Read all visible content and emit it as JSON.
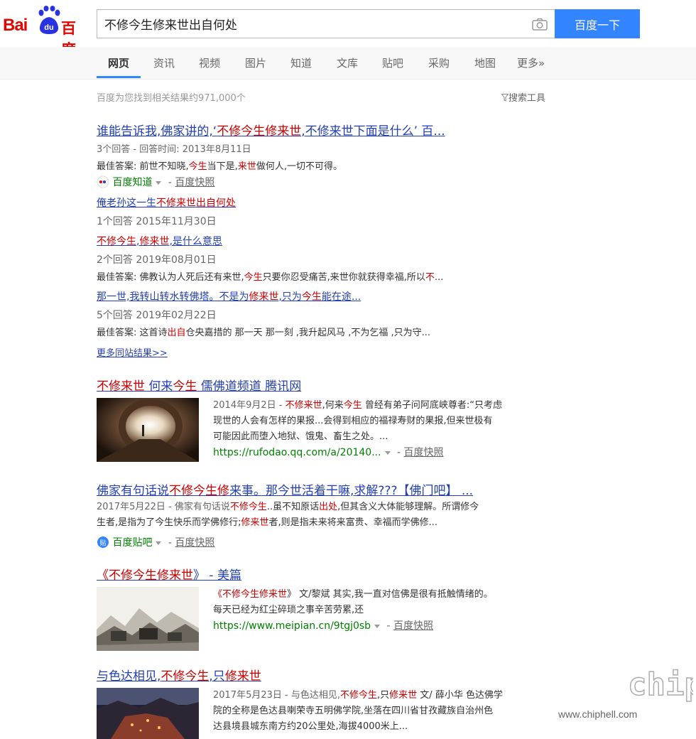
{
  "header": {
    "logo_left": "Bai",
    "logo_paw": "du",
    "logo_right": "百度",
    "query": "不修今生修来世出自何处",
    "search_button": "百度一下"
  },
  "tabs": [
    "网页",
    "资讯",
    "视频",
    "图片",
    "知道",
    "文库",
    "贴吧",
    "采购",
    "地图",
    "更多»"
  ],
  "meta": {
    "count": "百度为您找到相关结果约971,000个",
    "tools": "搜索工具"
  },
  "r1": {
    "t1": "谁能告诉我,佛家讲的,‘",
    "t2": "不修今生修来世",
    "t3": ",不修来世下面是什么’ 百...",
    "info": "3个回答 - 回答时间: 2013年8月11日",
    "a1": "最佳答案: 前世不知晓,",
    "a2": "今生",
    "a3": "当下是,",
    "a4": "来世",
    "a5": "做何人,一切不可得。",
    "source": "百度知道",
    "snap": "百度快照",
    "sub1_t1": "俺老孙这一生",
    "sub1_t2": "不修来世出自何处",
    "sub1_info": "1个回答  2015年11月30日",
    "sub2_t1": "不修今生",
    "sub2_t2": ",",
    "sub2_t3": "修来世",
    "sub2_t4": ",是什么意思",
    "sub2_info": "2个回答  2019年08月01日",
    "sub2_a1": "最佳答案:  佛教认为人死后还有来世,",
    "sub2_a2": "今生",
    "sub2_a3": "只要你忍受痛苦,来世你就获得幸福,所以",
    "sub2_a4": "不",
    "sub2_a5": "...",
    "sub3_t1": "那一世,我转山转水转佛塔。不是为",
    "sub3_t2": "修来世",
    "sub3_t3": ",只为",
    "sub3_t4": "今生",
    "sub3_t5": "能在途...",
    "sub3_info": "5个回答  2019年02月22日",
    "sub3_a1": "最佳答案:  这首诗",
    "sub3_a2": "出自",
    "sub3_a3": "仓央嘉措的 那一天 那一刻 ,我升起风马 ,不为乞福 ,只为守...",
    "more": "更多同站结果>>"
  },
  "r2": {
    "t1": "不修来世",
    "t2": " 何来",
    "t3": "今生",
    "t4": "   儒佛道频道  腾讯网",
    "s1": "2014年9月2日 - ",
    "s2": "不修来世",
    "s3": ",何来",
    "s4": "今生",
    "s5": " 曾经有弟子问阿底峡尊者:“只考虑",
    "s6": "现世的人会有怎样的果报...会得到相应的福禄寿财的果报,但来世极有",
    "s7": "可能因此而堕入地狱、饿鬼、畜生之处。...",
    "url": "https://rufodao.qq.com/a/20140...",
    "snap": "百度快照"
  },
  "r3": {
    "t1": "佛家有句话说",
    "t2": "不修今生修",
    "t3": "来事。那今世活着干嘛,求解???【佛门吧】 ...",
    "s1": "2017年5月22日 - 佛家有句话说",
    "s2": "不修今生",
    "s3": "..虽不知原话",
    "s4": "出处",
    "s5": ",但其含义大体能够理解。所谓修今",
    "s6": "生者,是指为了今生快乐而学佛修行;",
    "s7": "修来世",
    "s8": "者,则是指未来将来富贵、幸福而学佛修...",
    "source": "百度贴吧",
    "snap": "百度快照"
  },
  "r4": {
    "t1": "《",
    "t2": "不修今生修来世",
    "t3": "》 - 美篇",
    "s1": "《",
    "s2": "不修今生修来世",
    "s3": "》 文/黎斌 其实,我一直对信佛是很有抵触情绪的。",
    "s4": "每天已经为红尘碎琐之事辛苦劳累,还",
    "url": "https://www.meipian.cn/9tgj0sb",
    "snap": "百度快照"
  },
  "r5": {
    "t1": "与色达相见,",
    "t2": "不修今生",
    "t3": ",只",
    "t4": "修来世",
    "s1": "2017年5月23日 - 与色达相见,",
    "s2": "不修今生",
    "s3": ",只",
    "s4": "修来世",
    "s5": " 文/ 薛小华 色达佛学",
    "s6": "院的全称是色达县喇荣寺五明佛学院,坐落在四川省甘孜藏族自治州色",
    "s7": "达县境县城东南方约20公里处,海拔4000米上..."
  },
  "watermark": {
    "text": "www.chiphell.com",
    "logo": "chip hell"
  }
}
